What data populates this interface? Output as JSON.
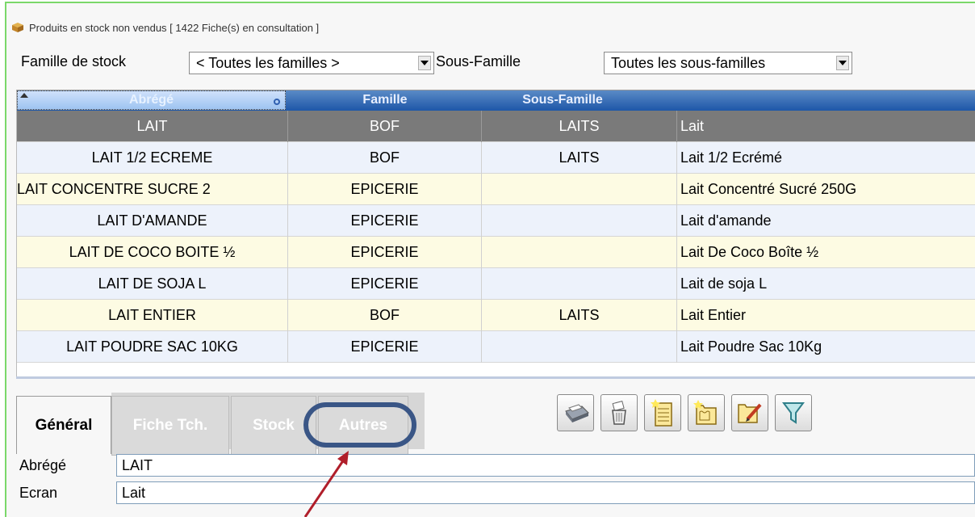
{
  "window": {
    "title": "Produits en stock non vendus  [ 1422 Fiche(s) en consultation ]",
    "icon": "box-icon"
  },
  "filters": {
    "famille_label": "Famille de stock",
    "famille_value": "< Toutes les familles >",
    "sous_famille_label": "Sous-Famille",
    "sous_famille_value": "Toutes les sous-familles"
  },
  "grid": {
    "columns": [
      "Abrégé",
      "Famille",
      "Sous-Famille"
    ],
    "rows": [
      {
        "abrege": "LAIT",
        "famille": "BOF",
        "sous_famille": "LAITS",
        "ecran": "Lait"
      },
      {
        "abrege": "LAIT 1/2 ECREME",
        "famille": "BOF",
        "sous_famille": "LAITS",
        "ecran": "Lait 1/2 Ecrémé"
      },
      {
        "abrege": "LAIT CONCENTRE SUCRE 2",
        "famille": "EPICERIE",
        "sous_famille": "",
        "ecran": "Lait Concentré Sucré 250G"
      },
      {
        "abrege": "LAIT D'AMANDE",
        "famille": "EPICERIE",
        "sous_famille": "",
        "ecran": "Lait d'amande"
      },
      {
        "abrege": "LAIT DE COCO BOITE ½",
        "famille": "EPICERIE",
        "sous_famille": "",
        "ecran": "Lait De Coco Boîte ½"
      },
      {
        "abrege": "LAIT DE SOJA L",
        "famille": "EPICERIE",
        "sous_famille": "",
        "ecran": "Lait de soja L"
      },
      {
        "abrege": "LAIT ENTIER",
        "famille": "BOF",
        "sous_famille": "LAITS",
        "ecran": "Lait Entier"
      },
      {
        "abrege": "LAIT POUDRE SAC 10KG",
        "famille": "EPICERIE",
        "sous_famille": "",
        "ecran": "Lait Poudre Sac 10Kg"
      }
    ]
  },
  "tabs": [
    {
      "label": "Général",
      "active": true
    },
    {
      "label": "Fiche Tch.",
      "active": false
    },
    {
      "label": "Stock",
      "active": false
    },
    {
      "label": "Autres",
      "active": false
    }
  ],
  "toolbar": {
    "buttons": [
      "printer-icon",
      "trash-icon",
      "new-document-icon",
      "new-folder-icon",
      "edit-document-icon",
      "filter-icon"
    ]
  },
  "form": {
    "abrege_label": "Abrégé",
    "abrege_value": "LAIT",
    "ecran_label": "Ecran",
    "ecran_value": "Lait"
  },
  "annotation": {
    "color": "#3a5686",
    "arrow_color": "#b01e2a"
  }
}
